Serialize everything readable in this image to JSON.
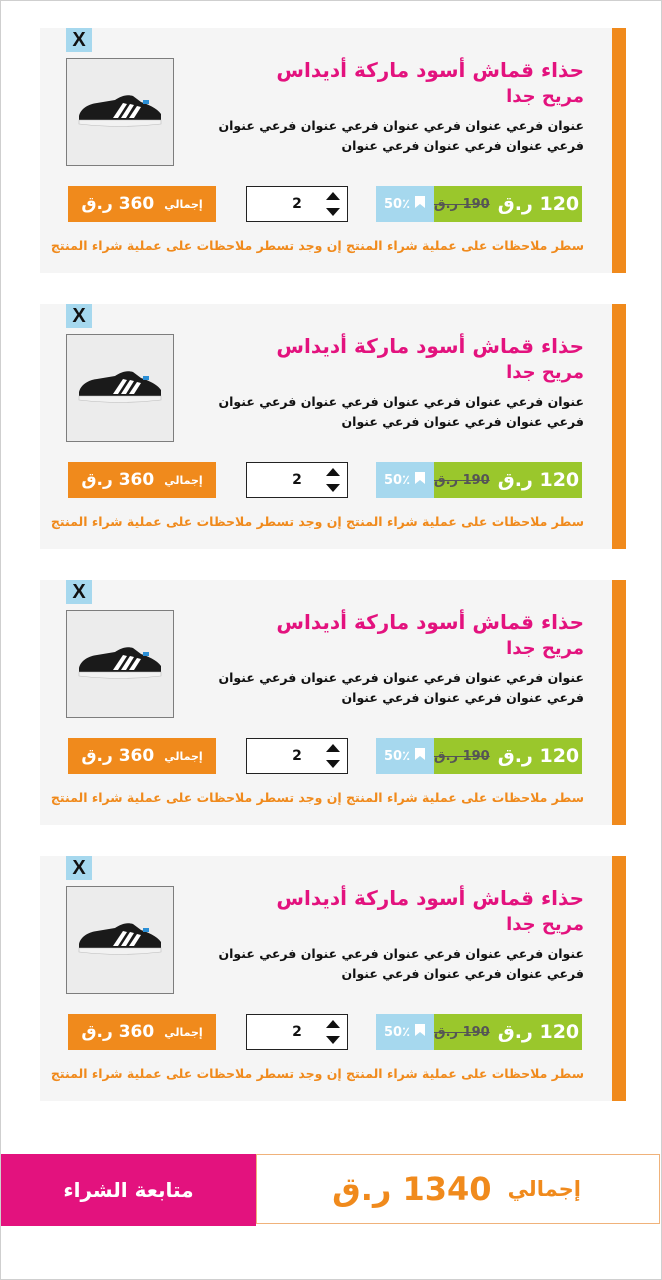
{
  "colors": {
    "accent_orange": "#f08a1c",
    "accent_pink": "#e3127e",
    "price_green": "#9ac72c",
    "discount_blue": "#a6d8ee",
    "card_background": "#f5f5f5"
  },
  "cart": {
    "items": [
      {
        "remove_label": "X",
        "image_icon": "sneaker-icon",
        "title": "حذاء قماش أسود ماركة أديداس",
        "subtitle": "مريح جدا",
        "description": "عنوان فرعي عنوان فرعي عنوان فرعي عنوان فرعي عنوان فرعي عنوان فرعي عنوان فرعي عنوان",
        "price": "120 ر.ق",
        "old_price": "190 ر.ق",
        "discount": "50٪",
        "discount_icon": "bookmark-icon",
        "quantity": "2",
        "total_label": "إجمالي",
        "total": "360 ر.ق",
        "note": "سطر ملاحظات على عملية شراء المنتج إن وجد تسطر ملاحظات على عملية شراء المنتج"
      },
      {
        "remove_label": "X",
        "image_icon": "sneaker-icon",
        "title": "حذاء قماش أسود ماركة أديداس",
        "subtitle": "مريح جدا",
        "description": "عنوان فرعي عنوان فرعي عنوان فرعي عنوان فرعي عنوان فرعي عنوان فرعي عنوان فرعي عنوان",
        "price": "120 ر.ق",
        "old_price": "190 ر.ق",
        "discount": "50٪",
        "discount_icon": "bookmark-icon",
        "quantity": "2",
        "total_label": "إجمالي",
        "total": "360 ر.ق",
        "note": "سطر ملاحظات على عملية شراء المنتج إن وجد تسطر ملاحظات على عملية شراء المنتج"
      },
      {
        "remove_label": "X",
        "image_icon": "sneaker-icon",
        "title": "حذاء قماش أسود ماركة أديداس",
        "subtitle": "مريح جدا",
        "description": "عنوان فرعي عنوان فرعي عنوان فرعي عنوان فرعي عنوان فرعي عنوان فرعي عنوان فرعي عنوان",
        "price": "120 ر.ق",
        "old_price": "190 ر.ق",
        "discount": "50٪",
        "discount_icon": "bookmark-icon",
        "quantity": "2",
        "total_label": "إجمالي",
        "total": "360 ر.ق",
        "note": "سطر ملاحظات على عملية شراء المنتج إن وجد تسطر ملاحظات على عملية شراء المنتج"
      },
      {
        "remove_label": "X",
        "image_icon": "sneaker-icon",
        "title": "حذاء قماش أسود ماركة أديداس",
        "subtitle": "مريح جدا",
        "description": "عنوان فرعي عنوان فرعي عنوان فرعي عنوان فرعي عنوان فرعي عنوان فرعي عنوان فرعي عنوان",
        "price": "120 ر.ق",
        "old_price": "190 ر.ق",
        "discount": "50٪",
        "discount_icon": "bookmark-icon",
        "quantity": "2",
        "total_label": "إجمالي",
        "total": "360 ر.ق",
        "note": "سطر ملاحظات على عملية شراء المنتج إن وجد تسطر ملاحظات على عملية شراء المنتج"
      }
    ]
  },
  "footer": {
    "checkout_label": "متابعة الشراء",
    "grand_total_label": "إجمالي",
    "grand_total": "1340 ر.ق"
  }
}
